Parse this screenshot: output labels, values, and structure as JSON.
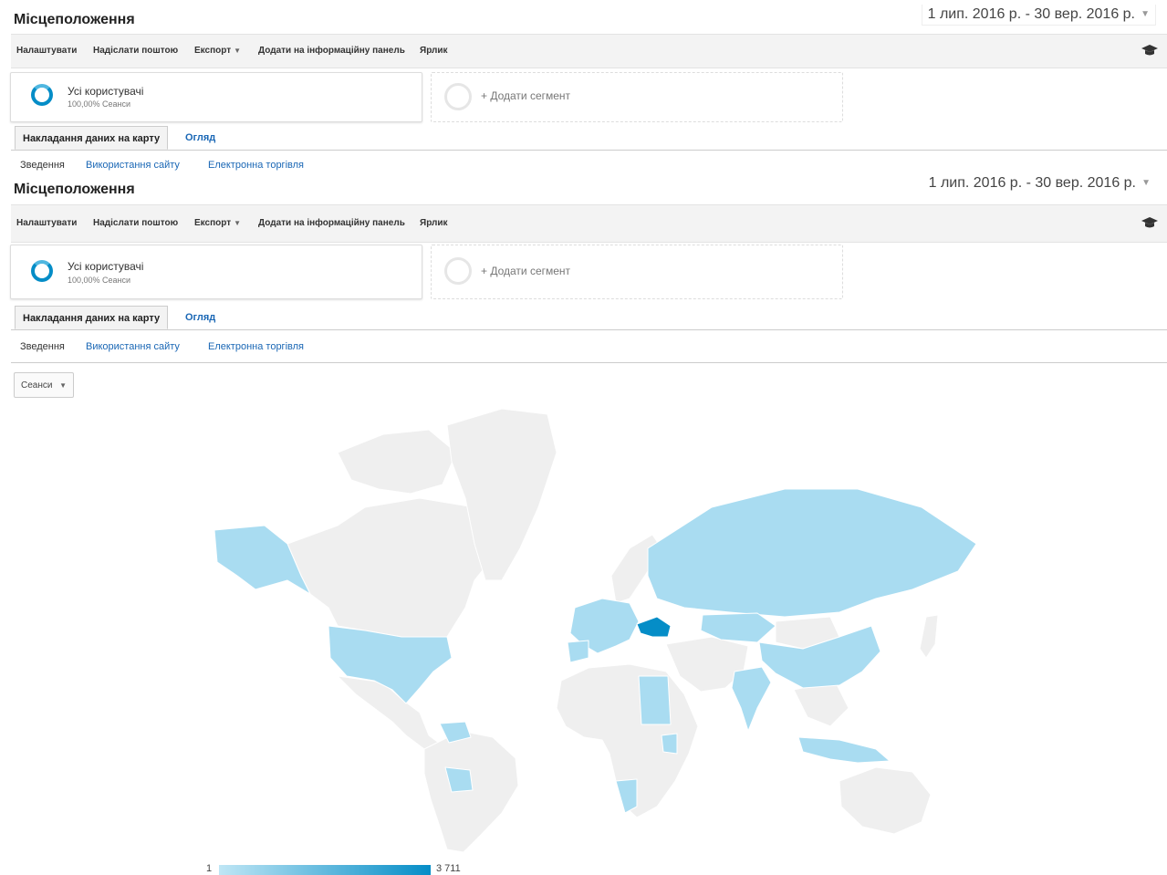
{
  "page": {
    "title": "Місцеположення",
    "date_range": "1 лип. 2016 р. - 30 вер. 2016 р."
  },
  "toolbar": {
    "customize": "Налаштувати",
    "email": "Надіслати поштою",
    "export": "Експорт",
    "add_dashboard": "Додати на інформаційну панель",
    "shortcut": "Ярлик"
  },
  "segments": {
    "all_users": "Усі користувачі",
    "all_users_sub": "100,00% Сеанси",
    "add_segment": "+ Додати сегмент"
  },
  "tabs": {
    "map_overlay": "Накладання даних на карту",
    "explorer": "Огляд"
  },
  "subtabs": {
    "summary": "Зведення",
    "site_usage": "Використання сайту",
    "ecommerce": "Електронна торгівля"
  },
  "metric_selector": "Сеанси",
  "map": {
    "legend_min": "1",
    "legend_max": "3 711",
    "colors": {
      "no_data": "#efefef",
      "low": "#a9dcf1",
      "high": "#058dc7",
      "border": "#ffffff"
    }
  }
}
